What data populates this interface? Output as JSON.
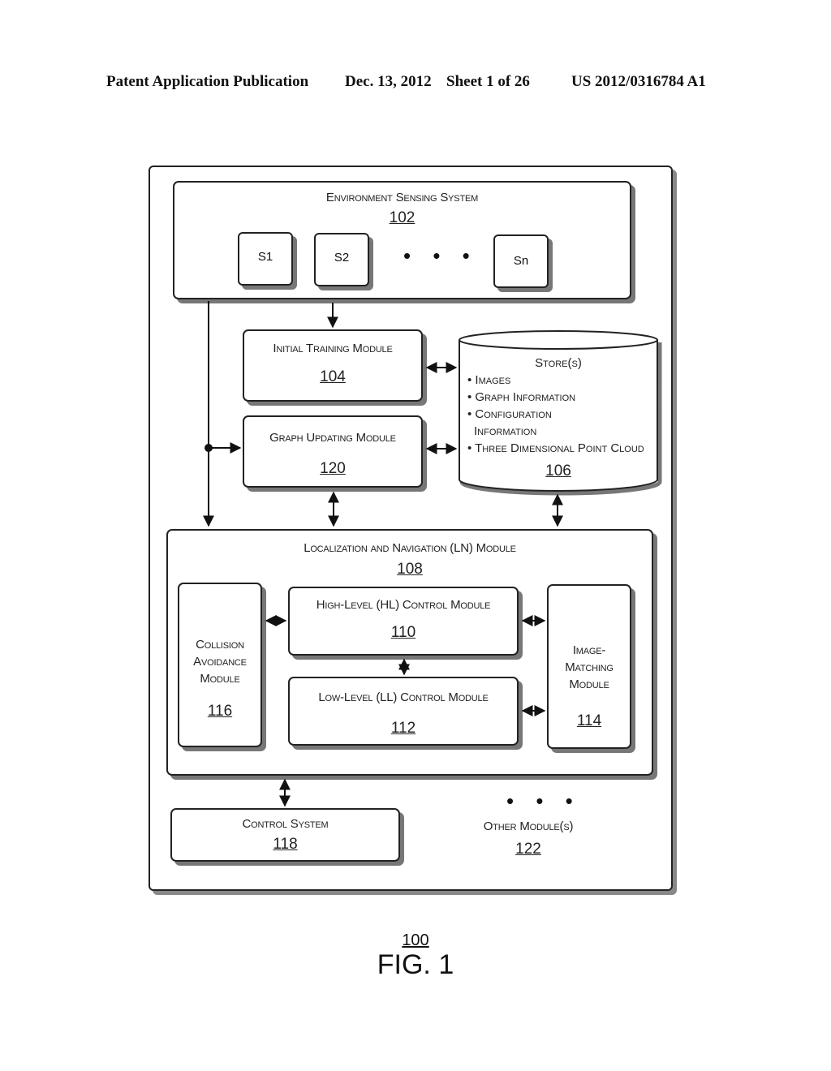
{
  "header": {
    "publication": "Patent Application Publication",
    "date": "Dec. 13, 2012",
    "sheet": "Sheet 1 of 26",
    "patent_number": "US 2012/0316784 A1"
  },
  "environment_sensing_system": {
    "label": "Environment Sensing System",
    "number": "102",
    "sensors": [
      "S1",
      "S2",
      "Sn"
    ],
    "ellipsis": "• • •"
  },
  "initial_training_module": {
    "label": "Initial Training Module",
    "number": "104"
  },
  "graph_updating_module": {
    "label": "Graph Updating Module",
    "number": "120"
  },
  "store": {
    "label": "Store(s)",
    "items": [
      "• Images",
      "• Graph Information",
      "• Configuration",
      "Information",
      "• Three Dimensional Point Cloud"
    ],
    "number": "106"
  },
  "ln_module": {
    "label": "Localization and Navigation (LN) Module",
    "number": "108"
  },
  "collision_avoidance_module": {
    "label_lines": [
      "Collision",
      "Avoidance",
      "Module"
    ],
    "number": "116"
  },
  "hl_control_module": {
    "label": "High-Level (HL) Control Module",
    "number": "110"
  },
  "ll_control_module": {
    "label": "Low-Level (LL) Control Module",
    "number": "112"
  },
  "image_matching_module": {
    "label_lines": [
      "Image-",
      "Matching",
      "Module"
    ],
    "number": "114"
  },
  "control_system": {
    "label": "Control System",
    "number": "118"
  },
  "other_modules": {
    "label": "Other Module(s)",
    "number": "122",
    "ellipsis": "• • •"
  },
  "figure": {
    "number": "100",
    "title": "FIG. 1"
  }
}
